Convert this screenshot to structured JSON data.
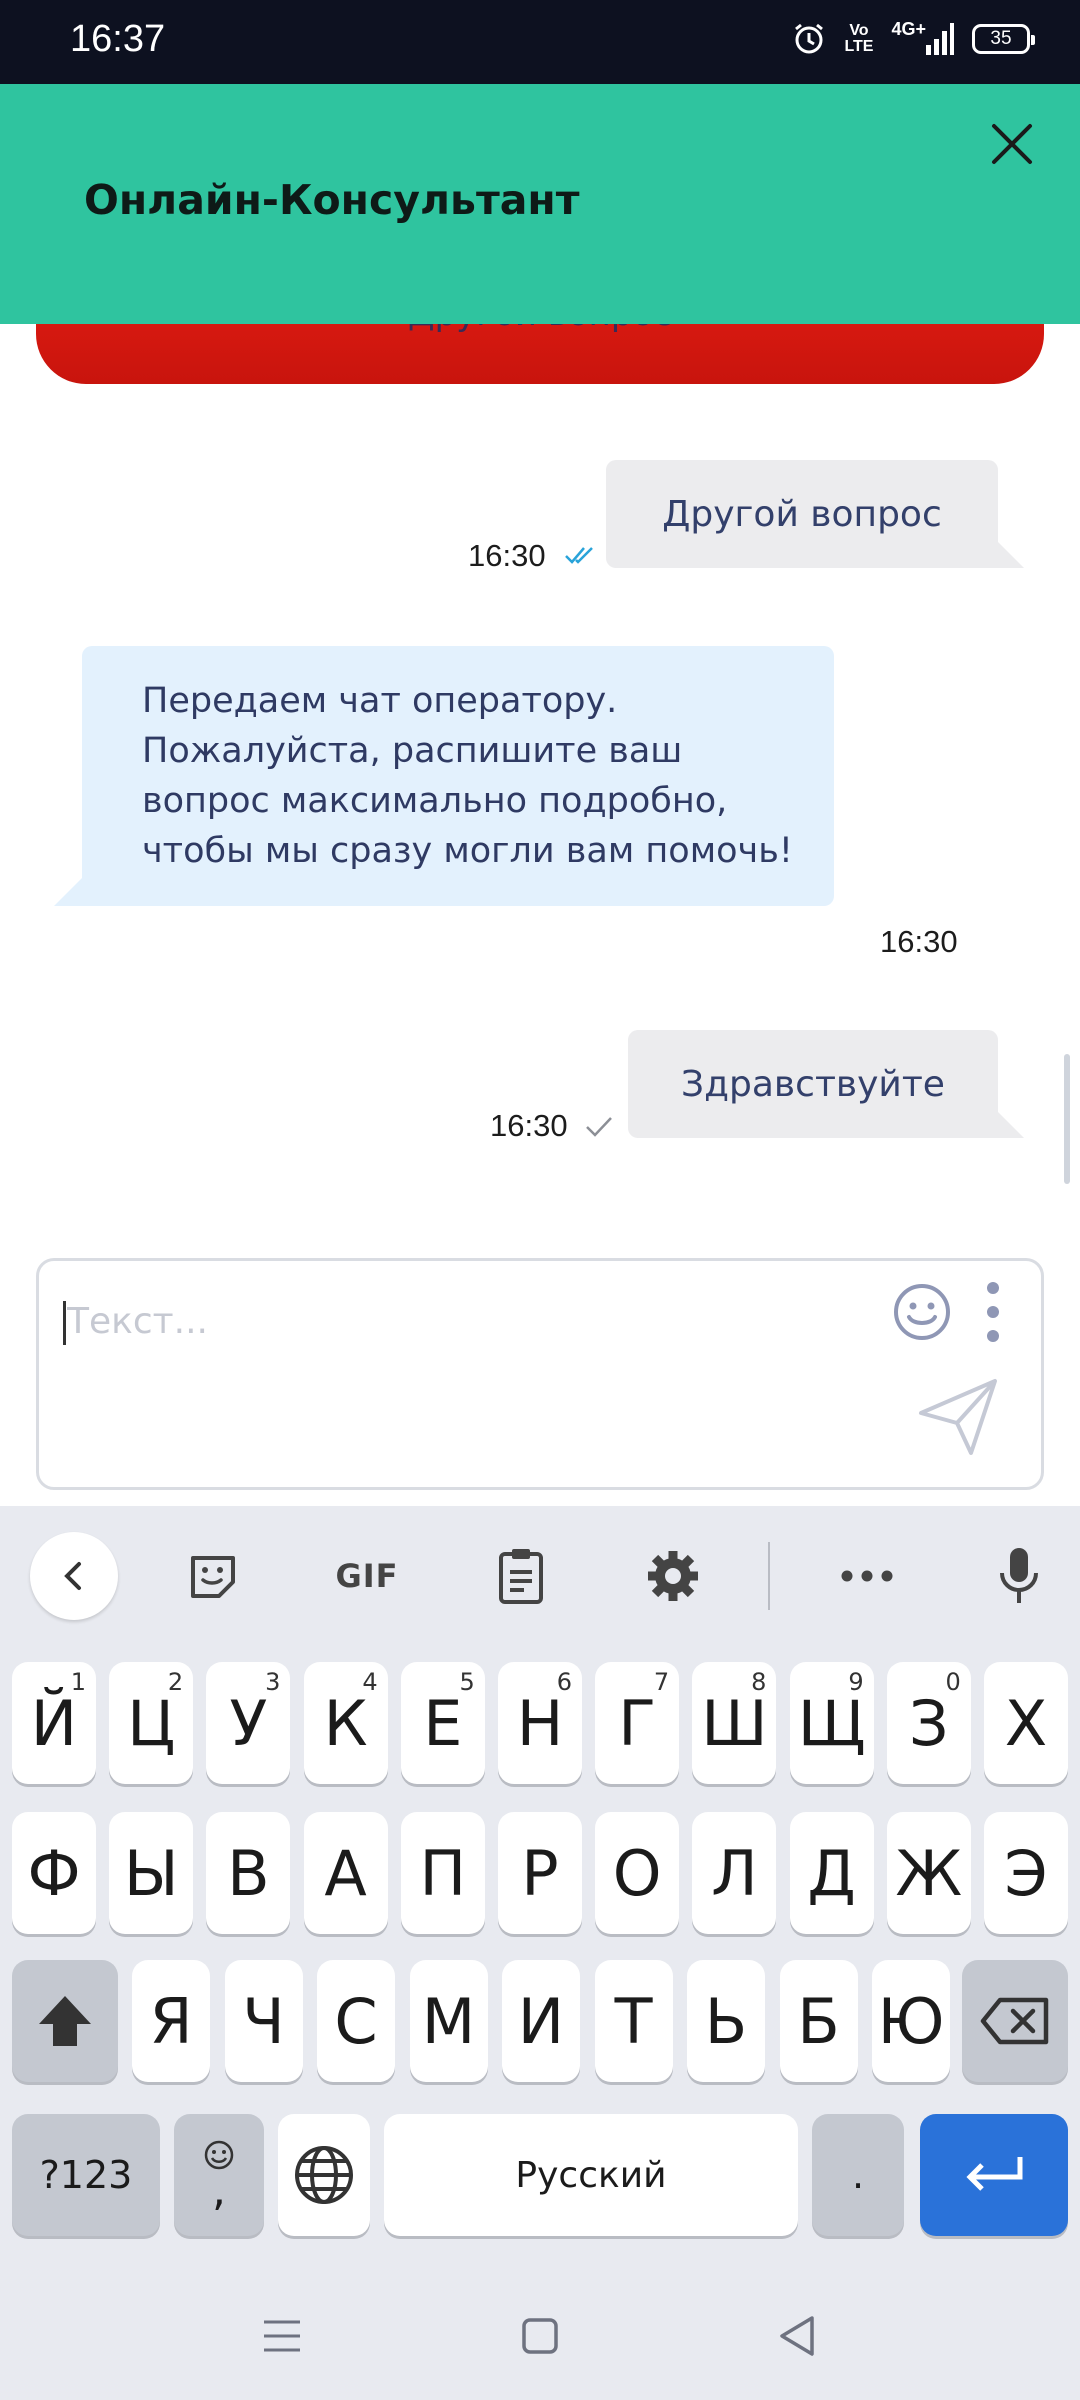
{
  "status_bar": {
    "time": "16:37",
    "volte_line1": "Vo",
    "volte_line2": "LTE",
    "network": "4G+",
    "battery": "35"
  },
  "header": {
    "title": "Онлайн-Консультант",
    "close_icon": "close-icon"
  },
  "chat": {
    "quick_reply_button": "Другой вопрос",
    "messages": [
      {
        "direction": "out",
        "text": "Другой вопрос",
        "time": "16:30",
        "status": "read"
      },
      {
        "direction": "in",
        "text": "Передаем чат оператору. Пожалуйста, распишите ваш вопрос максимально подробно, чтобы мы сразу могли вам помочь!",
        "time": "16:30"
      },
      {
        "direction": "out",
        "text": "Здравствуйте",
        "time": "16:30",
        "status": "sent"
      }
    ]
  },
  "composer": {
    "placeholder": "Текст...",
    "value": ""
  },
  "keyboard": {
    "row1": [
      {
        "k": "Й",
        "h": "1"
      },
      {
        "k": "Ц",
        "h": "2"
      },
      {
        "k": "У",
        "h": "3"
      },
      {
        "k": "К",
        "h": "4"
      },
      {
        "k": "Е",
        "h": "5"
      },
      {
        "k": "Н",
        "h": "6"
      },
      {
        "k": "Г",
        "h": "7"
      },
      {
        "k": "Ш",
        "h": "8"
      },
      {
        "k": "Щ",
        "h": "9"
      },
      {
        "k": "З",
        "h": "0"
      },
      {
        "k": "Х",
        "h": ""
      }
    ],
    "row2": [
      "Ф",
      "Ы",
      "В",
      "А",
      "П",
      "Р",
      "О",
      "Л",
      "Д",
      "Ж",
      "Э"
    ],
    "row3": [
      "Я",
      "Ч",
      "С",
      "М",
      "И",
      "Т",
      "Ь",
      "Б",
      "Ю"
    ],
    "symbols_label": "?123",
    "comma": ",",
    "space_label": "Русский",
    "period": ".",
    "toolbar_gif": "GIF"
  },
  "colors": {
    "header": "#2fc49f",
    "quick_reply": "#d5160f",
    "incoming_bubble": "#e3f1fd",
    "outgoing_bubble": "#ececee",
    "read_tick": "#29a3d9",
    "enter_key": "#2a72d9"
  }
}
